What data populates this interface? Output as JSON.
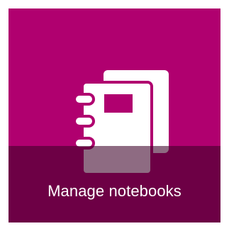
{
  "tile": {
    "label": "Manage notebooks",
    "icon": "notebooks-icon",
    "background_color": "#B0006F",
    "overlay_color": "rgba(60,0,40,0.58)"
  }
}
